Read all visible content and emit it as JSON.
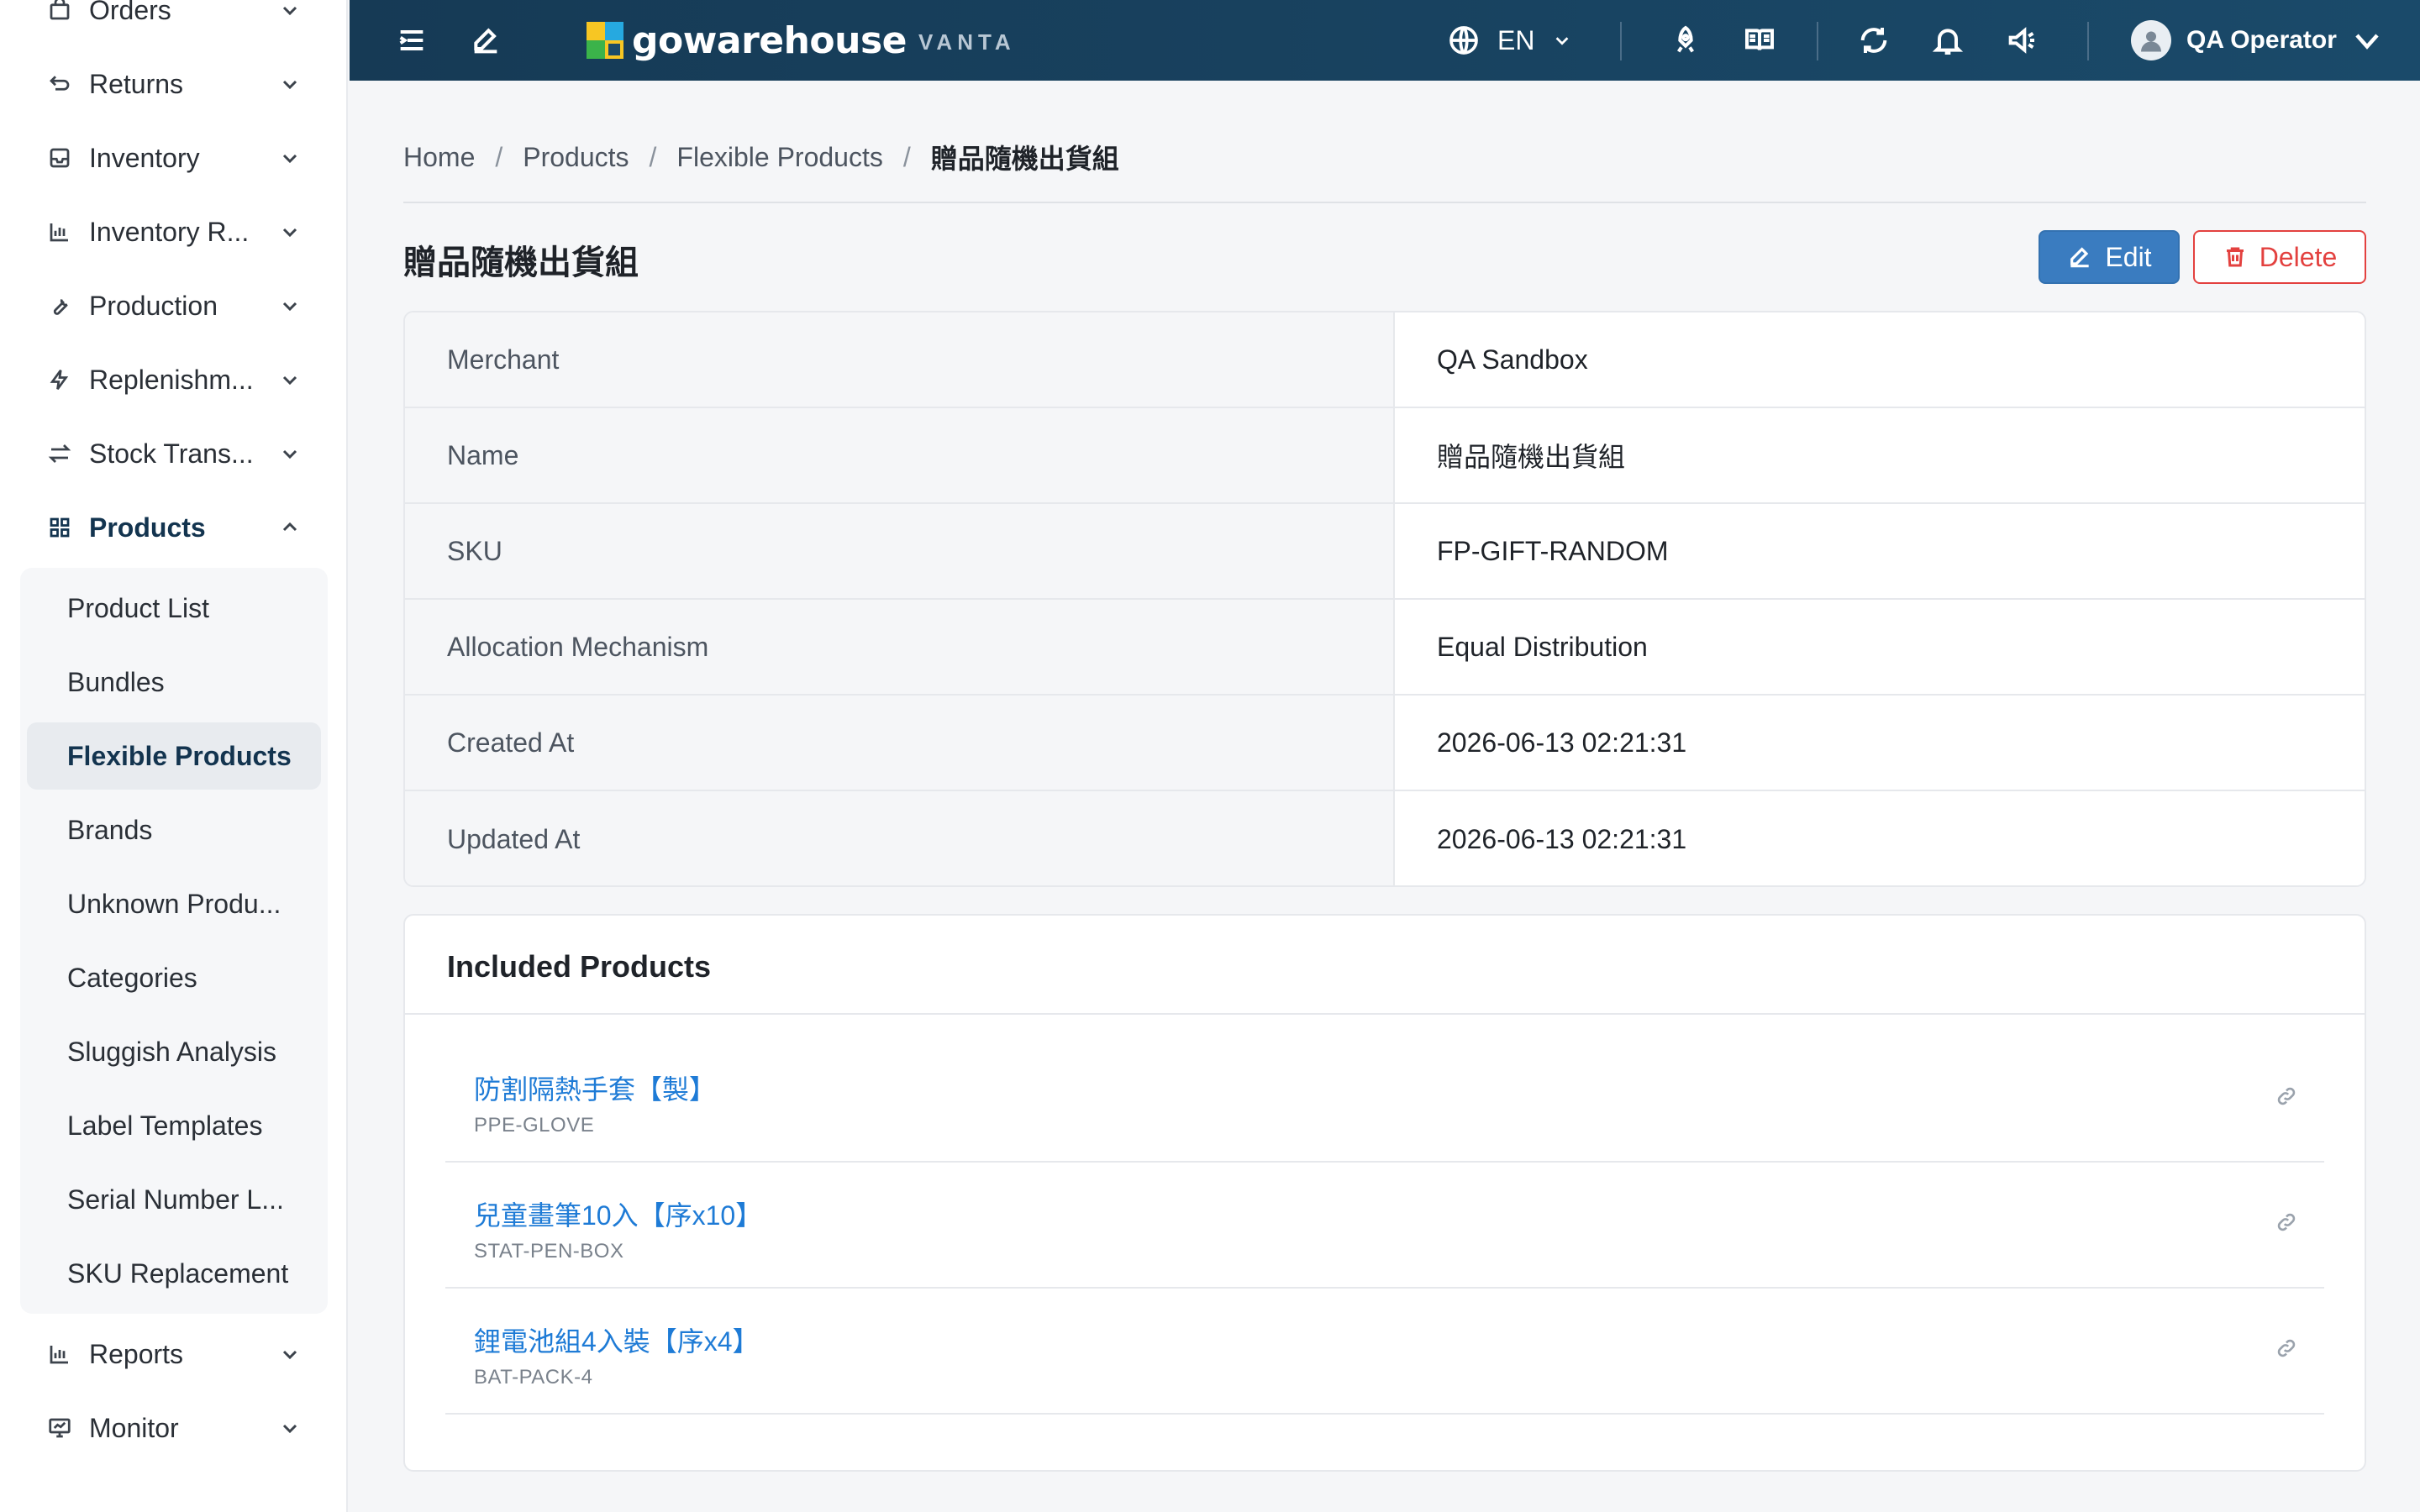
{
  "app": {
    "brand_name": "gowarehouse",
    "brand_sub": "VANTA",
    "language": "EN",
    "user_name": "QA Operator"
  },
  "sidebar": {
    "items": [
      {
        "label": "Orders",
        "icon": "shopping-bag-icon"
      },
      {
        "label": "Returns",
        "icon": "return-arrow-icon"
      },
      {
        "label": "Inventory",
        "icon": "inbox-icon"
      },
      {
        "label": "Inventory R...",
        "icon": "bar-chart-icon"
      },
      {
        "label": "Production",
        "icon": "wrench-icon"
      },
      {
        "label": "Replenishm...",
        "icon": "lightning-icon"
      },
      {
        "label": "Stock Trans...",
        "icon": "swap-arrows-icon"
      },
      {
        "label": "Products",
        "icon": "grid-icon"
      },
      {
        "label": "Reports",
        "icon": "bar-chart-icon"
      },
      {
        "label": "Monitor",
        "icon": "monitor-icon"
      }
    ],
    "product_subitems": [
      "Product List",
      "Bundles",
      "Flexible Products",
      "Brands",
      "Unknown Produ...",
      "Categories",
      "Sluggish Analysis",
      "Label Templates",
      "Serial Number L...",
      "SKU Replacement"
    ],
    "active_subitem": "Flexible Products"
  },
  "breadcrumb": [
    "Home",
    "Products",
    "Flexible Products",
    "贈品隨機出貨組"
  ],
  "page": {
    "title": "贈品隨機出貨組",
    "edit_label": "Edit",
    "delete_label": "Delete"
  },
  "details": [
    {
      "key": "Merchant",
      "value": "QA Sandbox"
    },
    {
      "key": "Name",
      "value": "贈品隨機出貨組"
    },
    {
      "key": "SKU",
      "value": "FP-GIFT-RANDOM"
    },
    {
      "key": "Allocation Mechanism",
      "value": "Equal Distribution"
    },
    {
      "key": "Created At",
      "value": "2026-06-13 02:21:31"
    },
    {
      "key": "Updated At",
      "value": "2026-06-13 02:21:31"
    }
  ],
  "included_products": {
    "title": "Included Products",
    "items": [
      {
        "name": "防割隔熱手套【製】",
        "sku": "PPE-GLOVE"
      },
      {
        "name": "兒童畫筆10入【序x10】",
        "sku": "STAT-PEN-BOX"
      },
      {
        "name": "鋰電池組4入裝【序x4】",
        "sku": "BAT-PACK-4"
      }
    ]
  },
  "colors": {
    "header_bg": "#163a55",
    "primary": "#3a7cc0",
    "danger": "#e3413f",
    "link": "#1e7bd6"
  }
}
